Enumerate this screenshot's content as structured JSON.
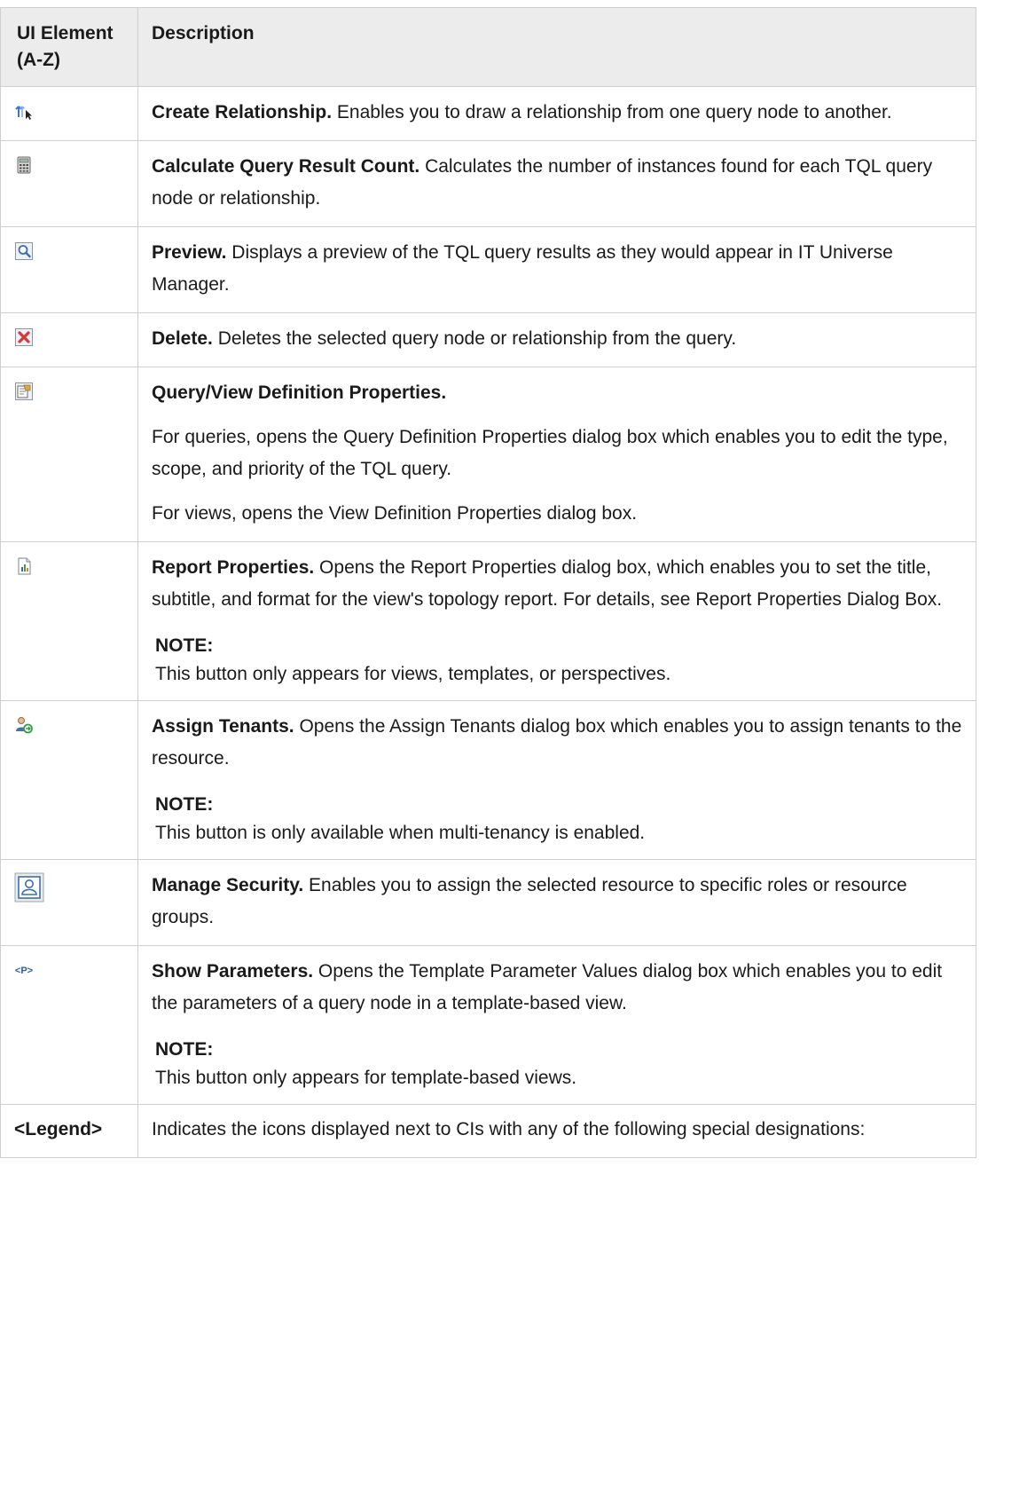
{
  "header": {
    "col1": "UI Element (A-Z)",
    "col2": "Description"
  },
  "rows": [
    {
      "icon": "create-relationship-icon",
      "label": "Create Relationship.",
      "text": " Enables you to draw a relationship from one query node to another."
    },
    {
      "icon": "calculator-icon",
      "label": "Calculate Query Result Count.",
      "text": " Calculates the number of instances found for each TQL query node or relationship."
    },
    {
      "icon": "preview-magnifier-icon",
      "label": "Preview.",
      "text": " Displays a preview of the TQL query results as they would appear in IT Universe Manager."
    },
    {
      "icon": "delete-x-icon",
      "label": "Delete.",
      "text": " Deletes the selected query node or relationship from the query."
    },
    {
      "icon": "properties-icon",
      "label": "Query/View Definition Properties.",
      "text": "",
      "para2": "For queries, opens the Query Definition Properties dialog box which enables you to edit the type, scope, and priority of the TQL query.",
      "para3": "For views, opens the View Definition Properties dialog box."
    },
    {
      "icon": "report-properties-icon",
      "label": "Report Properties.",
      "text": " Opens the Report Properties dialog box, which enables you to set the title, subtitle, and format for the view's topology report. For details, see Report Properties Dialog Box.",
      "note_label": "NOTE:",
      "note": "This button only appears for views, templates, or perspectives."
    },
    {
      "icon": "assign-tenants-icon",
      "label": "Assign Tenants.",
      "text": " Opens the Assign Tenants dialog box which enables you to assign tenants to the resource.",
      "note_label": "NOTE:",
      "note": "This button is only available when multi-tenancy is enabled."
    },
    {
      "icon": "manage-security-icon",
      "label": "Manage Security.",
      "text": " Enables you to assign the selected resource to specific roles or resource groups."
    },
    {
      "icon": "show-parameters-icon",
      "icon_text": "<P>",
      "label": "Show Parameters.",
      "text": " Opens the Template Parameter Values dialog box which enables you to edit the parameters of a query node in a template-based view.",
      "note_label": "NOTE:",
      "note": "This button only appears for template-based views."
    },
    {
      "element_text": "<Legend>",
      "text": "Indicates the icons displayed next to CIs with any of the following special designations:"
    }
  ]
}
